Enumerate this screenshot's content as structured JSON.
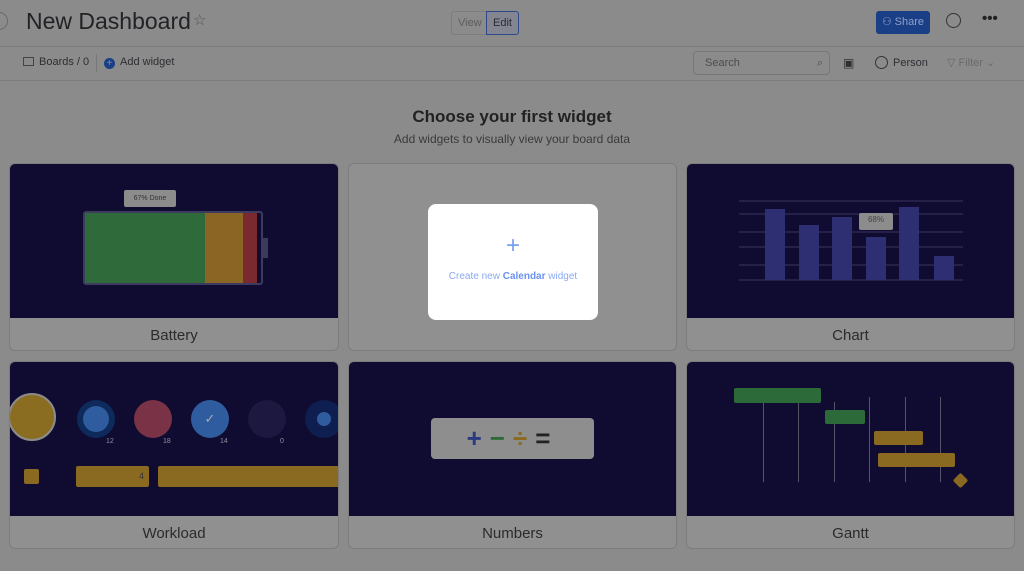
{
  "header": {
    "title": "New Dashboard",
    "view_label": "View",
    "edit_label": "Edit",
    "share_label": "Share"
  },
  "toolbar": {
    "boards_label": "Boards / 0",
    "add_widget_label": "Add widget",
    "search_placeholder": "Search",
    "person_label": "Person",
    "filter_label": "Filter"
  },
  "main": {
    "heading": "Choose your first widget",
    "subheading": "Add widgets to visually view your board data"
  },
  "popup": {
    "prefix": "Create new ",
    "widget": "Calendar",
    "suffix": " widget"
  },
  "widgets": [
    {
      "label": "Battery",
      "tooltip": "67% Done"
    },
    {
      "label": "Chart",
      "tooltip": "68%"
    },
    {
      "label": "Workload",
      "counts": [
        "12",
        "18",
        "14",
        "0"
      ],
      "bars": [
        "4",
        "8"
      ]
    },
    {
      "label": "Numbers"
    },
    {
      "label": "Gantt"
    }
  ],
  "colors": {
    "accent": "#1a3f86",
    "widget_bg": "#100b30"
  }
}
